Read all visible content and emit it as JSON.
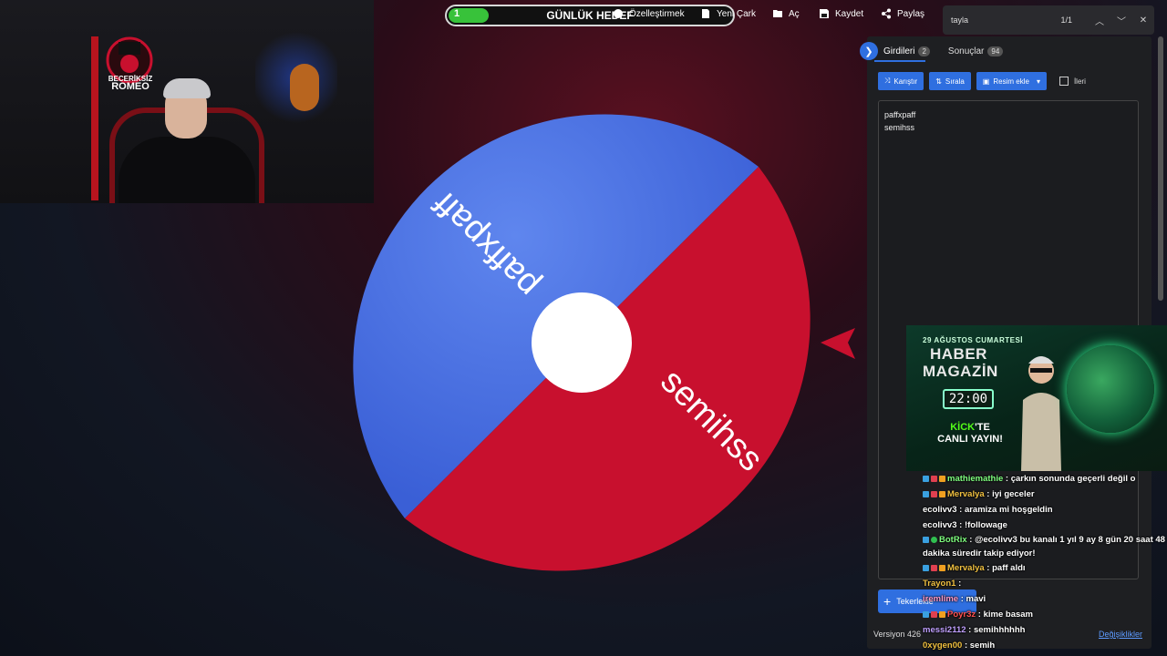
{
  "toolbar": {
    "goal_count": "1",
    "goal_label": "GÜNLÜK HEDEF",
    "goal_progress": 0.14,
    "customize": "Özelleştirmek",
    "new_wheel": "Yeni Çark",
    "open": "Aç",
    "save": "Kaydet",
    "share": "Paylaş"
  },
  "find": {
    "query": "tayla",
    "count": "1/1"
  },
  "webcam": {
    "logo_line1": "BECERİKSİZ",
    "logo_line2": "ROMEO"
  },
  "wheel": {
    "segments": [
      {
        "label": "paffxpaff",
        "color": "#3a5fd6"
      },
      {
        "label": "semihss",
        "color": "#c8102e"
      }
    ]
  },
  "panel": {
    "tab_inputs": "Girdileri",
    "tab_inputs_count": "2",
    "tab_results": "Sonuçlar",
    "tab_results_count": "94",
    "shuffle": "Karıştır",
    "sort": "Sırala",
    "add_image": "Resim ekle",
    "advanced": "İleri",
    "entries_text": "paffxpaff\nsemihss",
    "add_wheel": "Tekerlekle",
    "version": "Versiyon 426",
    "changes": "Değişiklikler"
  },
  "ad": {
    "date": "29 AĞUSTOS CUMARTESİ",
    "title_line1": "HABER",
    "title_line2": "MAGAZİN",
    "time": "22:00",
    "sub_green": "KİCK",
    "sub_rest": "'TE",
    "sub_line2": "CANLI YAYIN!"
  },
  "chat": [
    {
      "user": "mathiemathie",
      "color": "#7fff7f",
      "msg": " : çarkın sonunda geçerli değil o",
      "icons": [
        "i1",
        "i2",
        "i3"
      ]
    },
    {
      "user": "Mervalya",
      "color": "#f0c040",
      "msg": " : iyi geceler",
      "icons": [
        "i1",
        "i2",
        "i3"
      ]
    },
    {
      "user": "ecolivv3",
      "color": "#ffffff",
      "msg": " : aramiza mi hoşgeldin",
      "icons": []
    },
    {
      "user": "ecolivv3",
      "color": "#ffffff",
      "msg": " : !followage",
      "icons": []
    },
    {
      "user": "BotRix",
      "color": "#7fff7f",
      "msg": " : @ecolivv3 bu kanalı 1 yıl 9 ay 8 gün 20 saat 48 dakika süredir takip ediyor!",
      "icons": [
        "i1",
        "i4"
      ]
    },
    {
      "user": "Mervalya",
      "color": "#f0c040",
      "msg": " : paff aldı",
      "icons": [
        "i1",
        "i2",
        "i3"
      ]
    },
    {
      "user": "Trayon1",
      "color": "#f0c040",
      "msg": " : ",
      "icons": []
    },
    {
      "user": "iremlime",
      "color": "#ff9ac8",
      "msg": " : mavi",
      "icons": []
    },
    {
      "user": "Poyr3z",
      "color": "#ff5050",
      "msg": " : kime basam",
      "icons": [
        "i1",
        "i2",
        "i3"
      ]
    },
    {
      "user": "messi2112",
      "color": "#c0a0ff",
      "msg": " : semihhhhhh",
      "icons": []
    },
    {
      "user": "0xygen00",
      "color": "#f0c040",
      "msg": " : semih",
      "icons": []
    }
  ]
}
